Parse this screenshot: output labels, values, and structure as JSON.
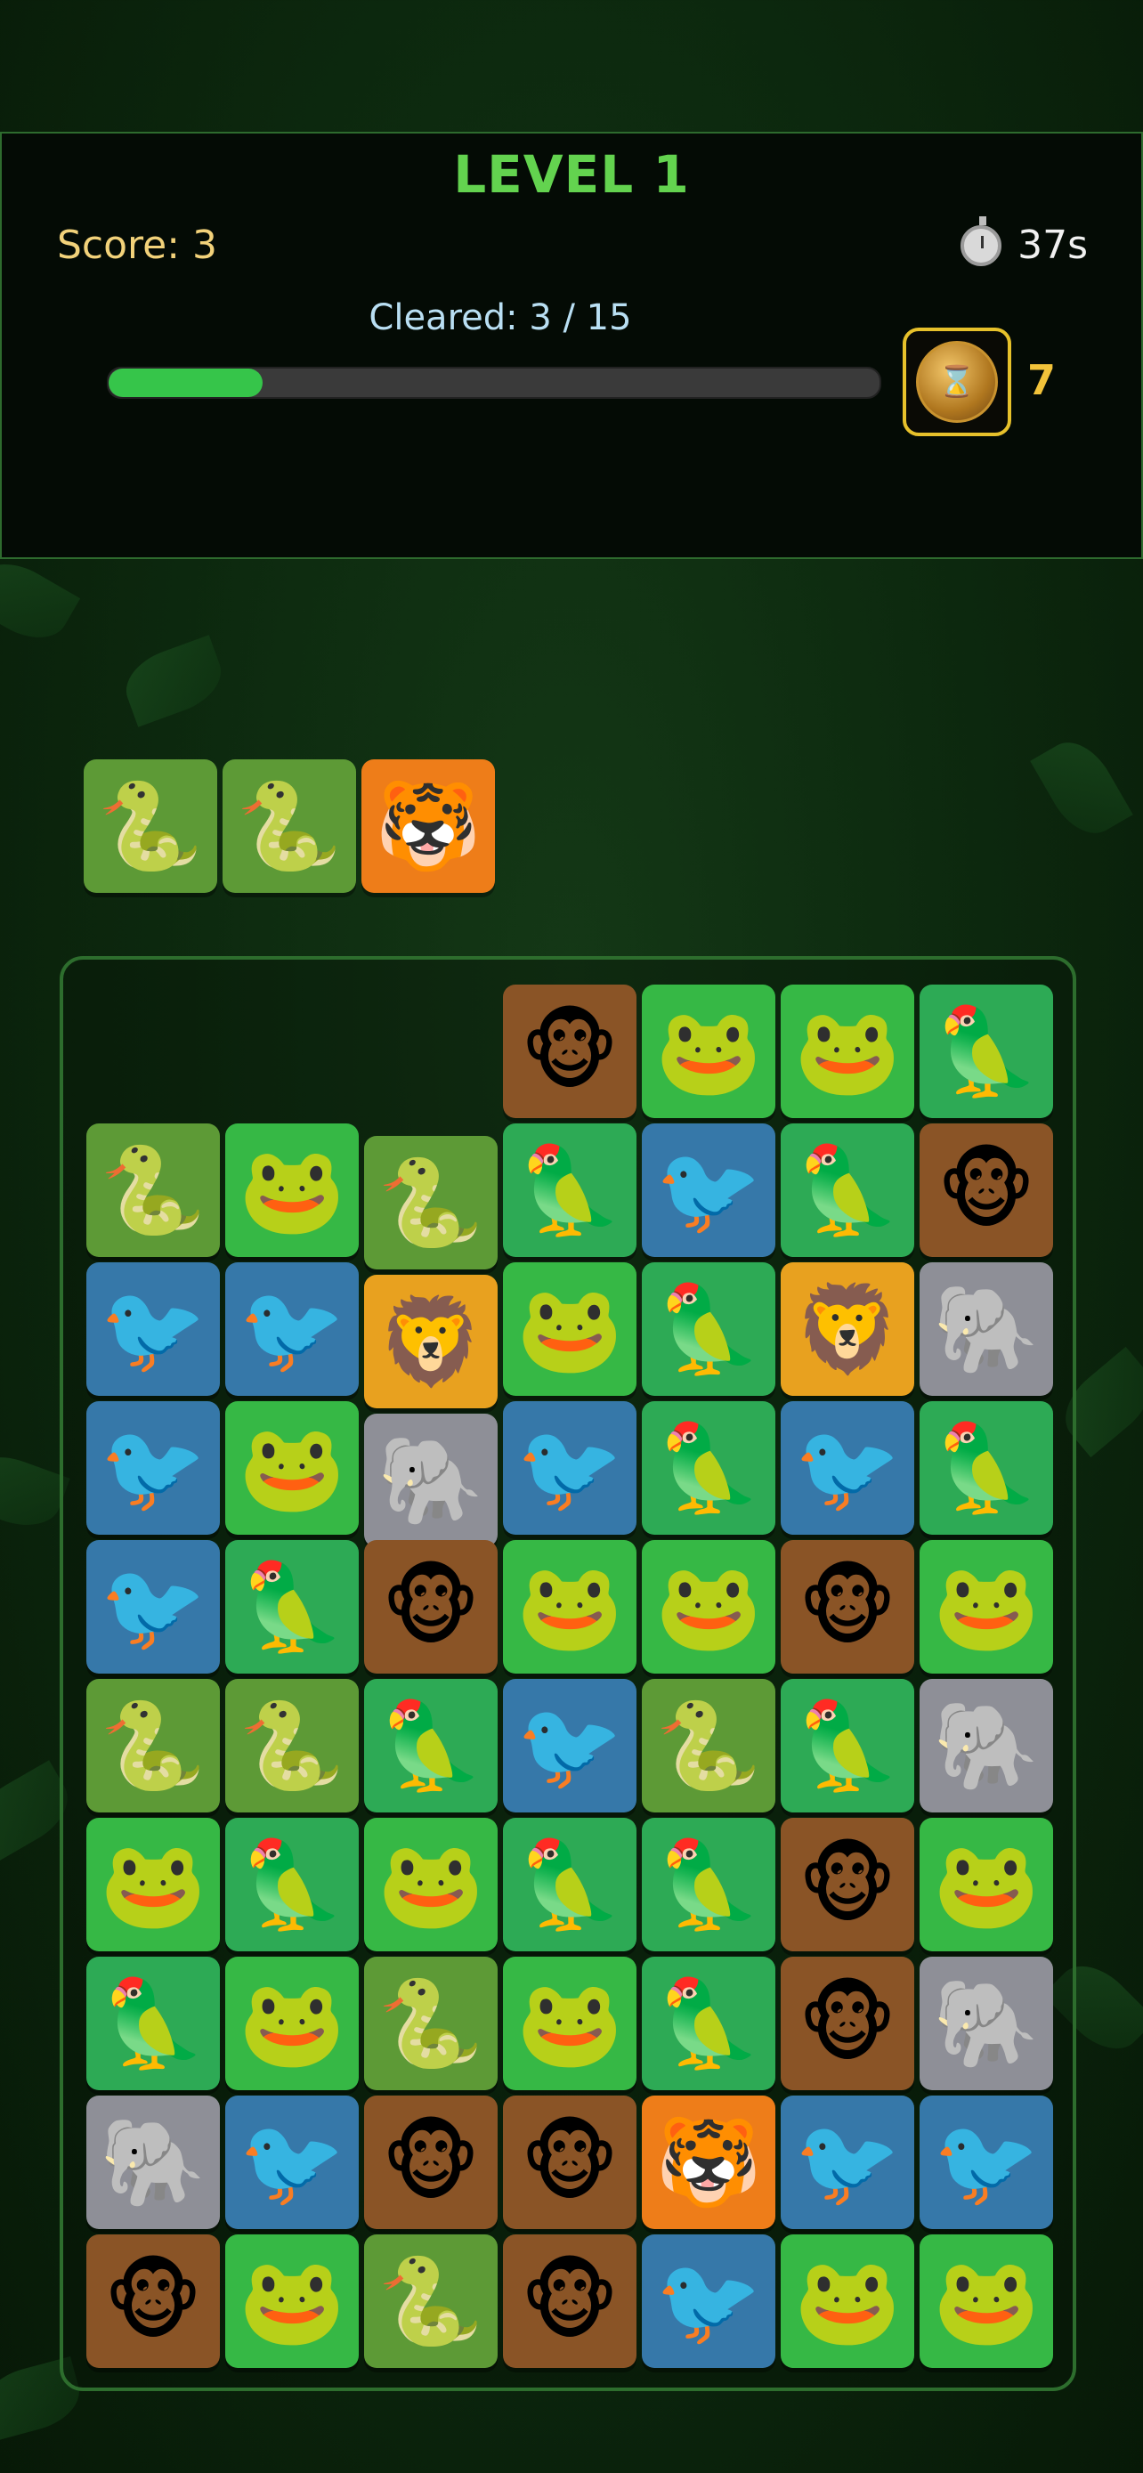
{
  "header": {
    "level_title": "LEVEL 1",
    "score_text": "Score: 3",
    "timer_text": "37s",
    "cleared_text": "Cleared: 3 / 15",
    "progress": 0.2,
    "powerup_count": "7",
    "powerup_icon": "hourglass-coin-icon"
  },
  "tile_types": {
    "snake": {
      "icon": "snake-icon",
      "glyph": "🐍",
      "color": "#5d9a36"
    },
    "frog": {
      "icon": "frog-icon",
      "glyph": "🐸",
      "color": "#36b845"
    },
    "parrot": {
      "icon": "parrot-icon",
      "glyph": "🦜",
      "color": "#2daa55"
    },
    "toucan": {
      "icon": "toucan-icon",
      "glyph": "🐦",
      "color": "#3678a9"
    },
    "monkey": {
      "icon": "monkey-icon",
      "glyph": "🐵",
      "color": "#8a5426"
    },
    "lion": {
      "icon": "lion-icon",
      "glyph": "🦁",
      "color": "#e8a11f"
    },
    "elephant": {
      "icon": "elephant-icon",
      "glyph": "🐘",
      "color": "#8e8f97"
    },
    "tiger": {
      "icon": "tiger-icon",
      "glyph": "🐯",
      "color": "#ee7d19"
    }
  },
  "slot_tray": [
    "snake",
    "snake",
    "tiger"
  ],
  "board": [
    [
      null,
      null,
      null,
      "monkey",
      "frog",
      "frog",
      "parrot"
    ],
    [
      "snake",
      "frog",
      "snake",
      "parrot",
      "toucan",
      "parrot",
      "monkey"
    ],
    [
      "toucan",
      "toucan",
      "lion",
      "frog",
      "parrot",
      "lion",
      "elephant"
    ],
    [
      "toucan",
      "frog",
      "elephant",
      "toucan",
      "parrot",
      "toucan",
      "parrot"
    ],
    [
      "toucan",
      "parrot",
      "monkey",
      "frog",
      "frog",
      "monkey",
      "frog"
    ],
    [
      "snake",
      "snake",
      "parrot",
      "toucan",
      "snake",
      "parrot",
      "elephant"
    ],
    [
      "frog",
      "parrot",
      "frog",
      "parrot",
      "parrot",
      "monkey",
      "frog"
    ],
    [
      "parrot",
      "frog",
      "snake",
      "frog",
      "parrot",
      "monkey",
      "elephant"
    ],
    [
      "elephant",
      "toucan",
      "monkey",
      "monkey",
      "tiger",
      "toucan",
      "toucan"
    ],
    [
      "monkey",
      "frog",
      "snake",
      "monkey",
      "toucan",
      "frog",
      "frog"
    ]
  ]
}
